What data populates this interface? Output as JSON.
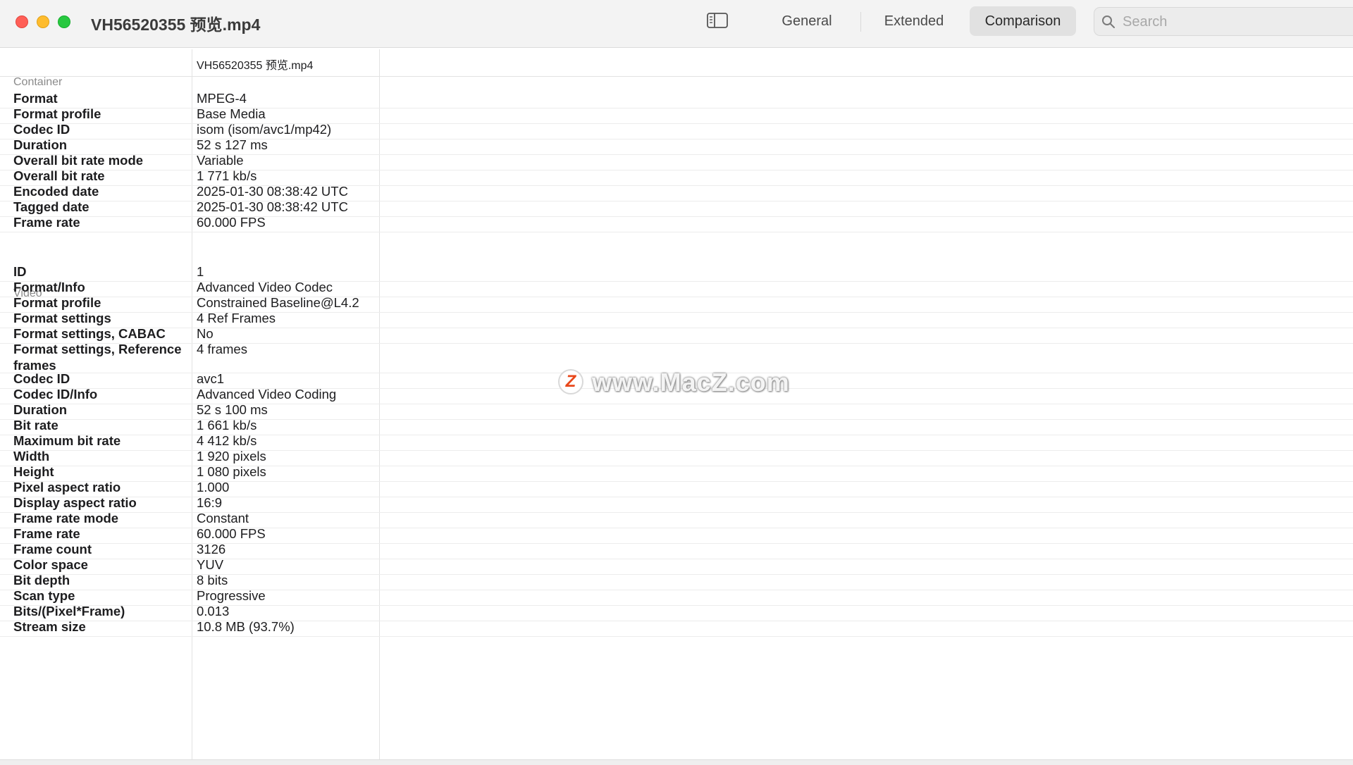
{
  "window": {
    "title": "VH56520355 预览.mp4"
  },
  "toolbar": {
    "tabs": [
      {
        "label": "General"
      },
      {
        "label": "Extended"
      },
      {
        "label": "Comparison",
        "selected": true
      }
    ],
    "search_placeholder": "Search"
  },
  "comparison": {
    "file_name": "VH56520355 预览.mp4",
    "container": {
      "section_label": "Container",
      "rows": [
        {
          "label": "Format",
          "value": "MPEG-4"
        },
        {
          "label": "Format profile",
          "value": "Base Media"
        },
        {
          "label": "Codec ID",
          "value": "isom (isom/avc1/mp42)"
        },
        {
          "label": "Duration",
          "value": "52 s 127 ms"
        },
        {
          "label": "Overall bit rate mode",
          "value": "Variable"
        },
        {
          "label": "Overall bit rate",
          "value": "1 771 kb/s"
        },
        {
          "label": "Encoded date",
          "value": "2025-01-30 08:38:42 UTC"
        },
        {
          "label": "Tagged date",
          "value": "2025-01-30 08:38:42 UTC"
        },
        {
          "label": "Frame rate",
          "value": "60.000 FPS"
        }
      ]
    },
    "video": {
      "section_label": "Video",
      "rows": [
        {
          "label": "ID",
          "value": "1"
        },
        {
          "label": "Format/Info",
          "value": "Advanced Video Codec"
        },
        {
          "label": "Format profile",
          "value": "Constrained Baseline@L4.2"
        },
        {
          "label": "Format settings",
          "value": "4 Ref Frames"
        },
        {
          "label": "Format settings, CABAC",
          "value": "No"
        },
        {
          "label": "Format settings, Reference frames",
          "value": "4 frames"
        },
        {
          "label": "Codec ID",
          "value": "avc1"
        },
        {
          "label": "Codec ID/Info",
          "value": "Advanced Video Coding"
        },
        {
          "label": "Duration",
          "value": "52 s 100 ms"
        },
        {
          "label": "Bit rate",
          "value": "1 661 kb/s"
        },
        {
          "label": "Maximum bit rate",
          "value": "4 412 kb/s"
        },
        {
          "label": "Width",
          "value": "1 920 pixels"
        },
        {
          "label": "Height",
          "value": "1 080 pixels"
        },
        {
          "label": "Pixel aspect ratio",
          "value": "1.000"
        },
        {
          "label": "Display aspect ratio",
          "value": "16:9"
        },
        {
          "label": "Frame rate mode",
          "value": "Constant"
        },
        {
          "label": "Frame rate",
          "value": "60.000 FPS"
        },
        {
          "label": "Frame count",
          "value": "3126"
        },
        {
          "label": "Color space",
          "value": "YUV"
        },
        {
          "label": "Bit depth",
          "value": "8 bits"
        },
        {
          "label": "Scan type",
          "value": "Progressive"
        },
        {
          "label": "Bits/(Pixel*Frame)",
          "value": "0.013"
        },
        {
          "label": "Stream size",
          "value": "10.8 MB (93.7%)"
        }
      ]
    }
  },
  "watermark": {
    "badge": "Z",
    "text": "www.MacZ.com"
  }
}
